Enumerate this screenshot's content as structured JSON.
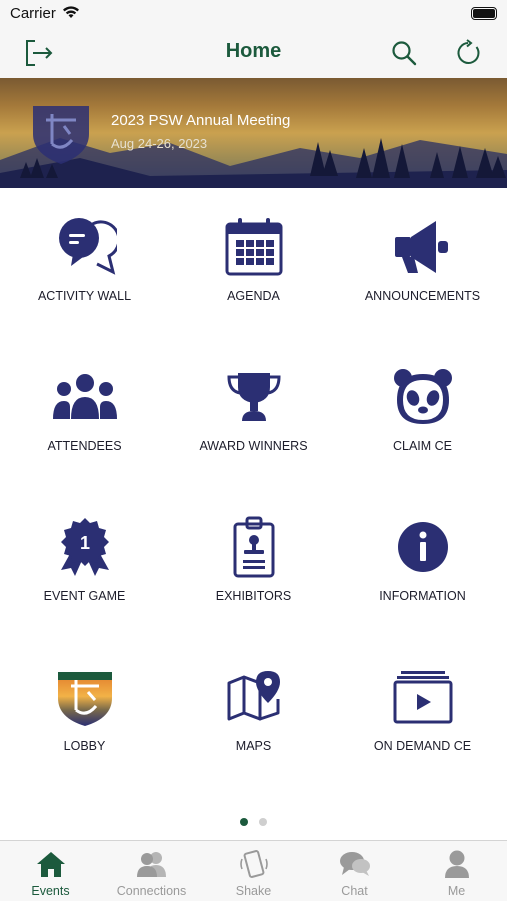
{
  "status_bar": {
    "carrier": "Carrier"
  },
  "nav": {
    "title": "Home",
    "accent_color": "#1c5a3d"
  },
  "banner": {
    "title": "2023 PSW Annual Meeting",
    "dates": "Aug 24-26, 2023"
  },
  "tiles": [
    {
      "label": "ACTIVITY WALL",
      "icon": "chat-bubbles-icon"
    },
    {
      "label": "AGENDA",
      "icon": "calendar-icon"
    },
    {
      "label": "ANNOUNCEMENTS",
      "icon": "megaphone-icon"
    },
    {
      "label": "ATTENDEES",
      "icon": "people-group-icon"
    },
    {
      "label": "AWARD WINNERS",
      "icon": "trophy-icon"
    },
    {
      "label": "CLAIM CE",
      "icon": "panda-icon"
    },
    {
      "label": "EVENT GAME",
      "icon": "ribbon-badge-icon"
    },
    {
      "label": "EXHIBITORS",
      "icon": "id-badge-icon"
    },
    {
      "label": "INFORMATION",
      "icon": "info-icon"
    },
    {
      "label": "LOBBY",
      "icon": "psw-shield-logo"
    },
    {
      "label": "MAPS",
      "icon": "map-pin-icon"
    },
    {
      "label": "ON DEMAND CE",
      "icon": "video-play-icon"
    }
  ],
  "pager": {
    "current_page": 1,
    "total_pages": 2
  },
  "tab_bar": {
    "items": [
      {
        "label": "Events",
        "icon": "house-icon",
        "active": true
      },
      {
        "label": "Connections",
        "icon": "contacts-icon",
        "active": false
      },
      {
        "label": "Shake",
        "icon": "phone-shake-icon",
        "active": false
      },
      {
        "label": "Chat",
        "icon": "chat-icon",
        "active": false
      },
      {
        "label": "Me",
        "icon": "person-icon",
        "active": false
      }
    ],
    "active_color": "#1c5a3d",
    "inactive_color": "#9a9a9a"
  },
  "colors": {
    "icon_navy": "#2b2f73",
    "accent_green": "#1c5a3d"
  }
}
